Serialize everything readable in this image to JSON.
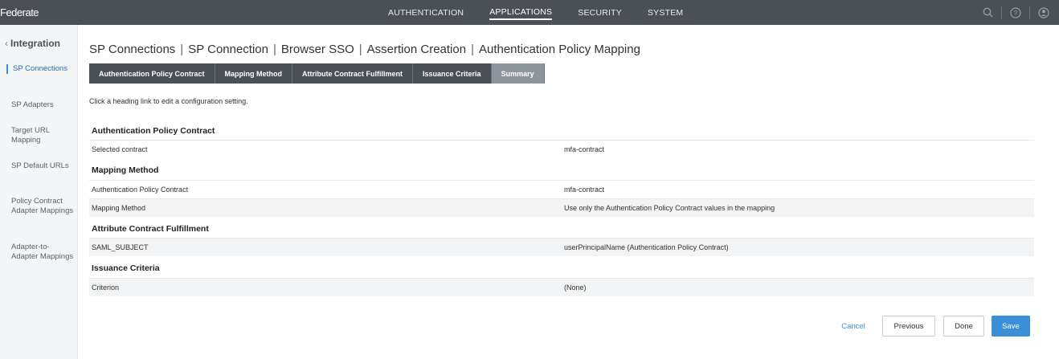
{
  "app": {
    "logo": "Federate"
  },
  "nav": {
    "items": [
      "AUTHENTICATION",
      "APPLICATIONS",
      "SECURITY",
      "SYSTEM"
    ],
    "active": "APPLICATIONS"
  },
  "top_icons": [
    "search-icon",
    "help-icon",
    "user-icon"
  ],
  "sidebar": {
    "heading": "Integration",
    "items": [
      {
        "label": "SP Connections",
        "active": true
      },
      {
        "label": "SP Adapters"
      },
      {
        "label": "Target URL Mapping"
      },
      {
        "label": "SP Default URLs"
      },
      {
        "label": "Policy Contract Adapter Mappings"
      },
      {
        "label": "Adapter-to-Adapter Mappings"
      }
    ]
  },
  "breadcrumb": [
    "SP Connections",
    "SP Connection",
    "Browser SSO",
    "Assertion Creation",
    "Authentication Policy Mapping"
  ],
  "tabs": [
    {
      "label": "Authentication Policy Contract"
    },
    {
      "label": "Mapping Method"
    },
    {
      "label": "Attribute Contract Fulfillment"
    },
    {
      "label": "Issuance Criteria"
    },
    {
      "label": "Summary",
      "active": true
    }
  ],
  "hint": "Click a heading link to edit a configuration setting.",
  "sections": [
    {
      "title": "Authentication Policy Contract",
      "rows": [
        {
          "key": "Selected contract",
          "value": "mfa-contract"
        }
      ]
    },
    {
      "title": "Mapping Method",
      "rows": [
        {
          "key": "Authentication Policy Contract",
          "value": "mfa-contract"
        },
        {
          "key": "Mapping Method",
          "value": "Use only the Authentication Policy Contract values in the mapping"
        }
      ]
    },
    {
      "title": "Attribute Contract Fulfillment",
      "rows": [
        {
          "key": "SAML_SUBJECT",
          "value": "userPrincipalName (Authentication Policy Contract)"
        }
      ]
    },
    {
      "title": "Issuance Criteria",
      "rows": [
        {
          "key": "Criterion",
          "value": "(None)"
        }
      ]
    }
  ],
  "buttons": {
    "cancel": "Cancel",
    "previous": "Previous",
    "done": "Done",
    "save": "Save"
  },
  "colors": {
    "topbar": "#4b5057",
    "accent": "#3b8fd6",
    "active_tab": "#8d959d"
  }
}
